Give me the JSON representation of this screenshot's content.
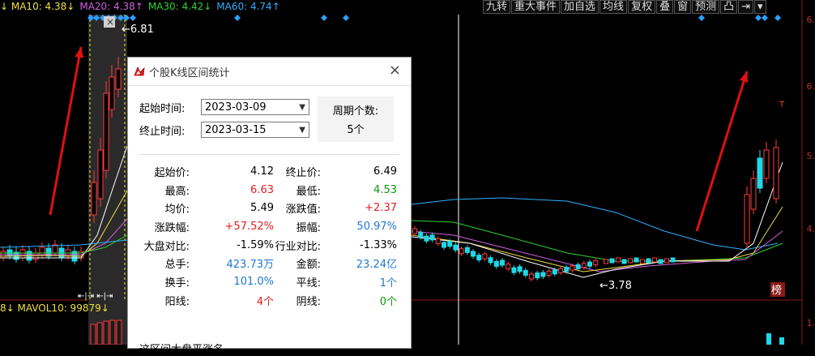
{
  "colors": {
    "up": "#ff3b3b",
    "down": "#1ed8e8",
    "neutral": "#0000ff",
    "ma5": "#ffffff",
    "ma10": "#f0e040",
    "ma20": "#d060e0",
    "ma30": "#30d030",
    "ma60": "#30b0ff",
    "accent_blue": "#1f77d0",
    "green_text": "#0a9a0a",
    "red_text": "#e02020"
  },
  "ma_bar": [
    {
      "text": "↓ MA10: 4.38↓",
      "color": "#f0e040"
    },
    {
      "text": "MA20: 4.38↑",
      "color": "#d060e0"
    },
    {
      "text": "MA30: 4.42↓",
      "color": "#30d030"
    },
    {
      "text": "MA60: 4.74↑",
      "color": "#30b0ff"
    }
  ],
  "vol_bar": {
    "text": "8↓ MAVOL10: 99879↓",
    "color": "#f0e040"
  },
  "toolbar": [
    "九转",
    "重大事件",
    "加自选",
    "均线",
    "复权",
    "叠",
    "窗",
    "预测",
    "凸",
    "⇥",
    "▾"
  ],
  "right_axis": [
    "6.",
    "6.",
    "5.",
    "4.",
    "1."
  ],
  "annotations": {
    "high_label": "←6.81",
    "low_label": "←3.78",
    "top_mark": "T",
    "bang_badge": "榜",
    "range_handles": "⇤|⇥ ⇤|⇥"
  },
  "dialog": {
    "title": "个股K线区间统计",
    "close": "×",
    "start_label": "起始时间:",
    "start_value": "2023-03-09",
    "end_label": "终止时间:",
    "end_value": "2023-03-15",
    "period_label": "周期个数:",
    "period_value": "5个",
    "stats": [
      {
        "l1": "起始价:",
        "v1": "4.12",
        "c1": "black",
        "l2": "终止价:",
        "v2": "6.49",
        "c2": "black"
      },
      {
        "l1": "最高:",
        "v1": "6.63",
        "c1": "red",
        "l2": "最低:",
        "v2": "4.53",
        "c2": "green"
      },
      {
        "l1": "均价:",
        "v1": "5.49",
        "c1": "black",
        "l2": "涨跌值:",
        "v2": "+2.37",
        "c2": "red"
      },
      {
        "l1": "涨跌幅:",
        "v1": "+57.52%",
        "c1": "red",
        "l2": "振幅:",
        "v2": "50.97%",
        "c2": "blue"
      },
      {
        "l1": "大盘对比:",
        "v1": "-1.59%",
        "c1": "black",
        "l2": "行业对比:",
        "v2": "-1.33%",
        "c2": "black"
      },
      {
        "l1": "总手:",
        "v1": "423.73万",
        "c1": "blue",
        "l2": "金额:",
        "v2": "23.24亿",
        "c2": "blue"
      },
      {
        "l1": "换手:",
        "v1": "101.0%",
        "c1": "blue",
        "l2": "平线:",
        "v2": "1个",
        "c2": "blue"
      },
      {
        "l1": "阳线:",
        "v1": "4个",
        "c1": "red",
        "l2": "阴线:",
        "v2": "0个",
        "c2": "green"
      }
    ],
    "bottom_text": "这区间大盘平涨名"
  }
}
